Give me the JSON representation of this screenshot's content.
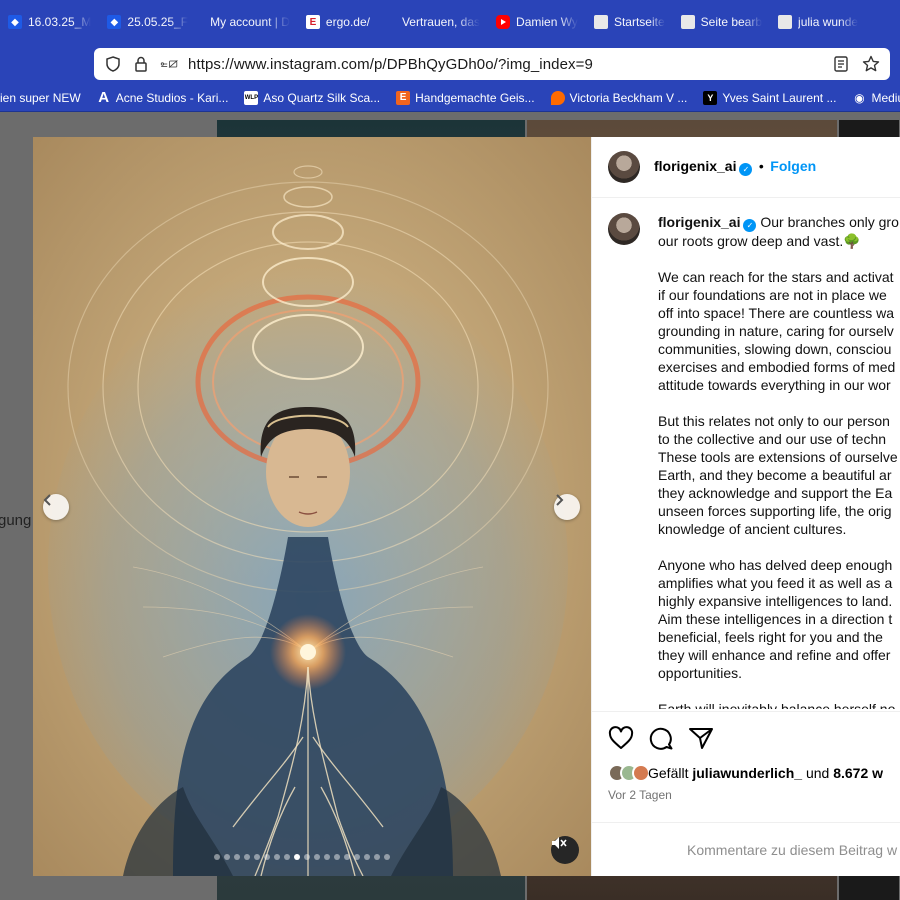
{
  "tabs": [
    {
      "label": "16.03.25_M",
      "icon": "dropbox-icon"
    },
    {
      "label": "25.05.25_F",
      "icon": "dropbox-icon"
    },
    {
      "label": "My account | D",
      "icon": "none"
    },
    {
      "label": "ergo.de/",
      "icon": "ergo-icon"
    },
    {
      "label": "Vertrauen, das",
      "icon": "none"
    },
    {
      "label": "Damien Wy",
      "icon": "youtube-icon"
    },
    {
      "label": "Startseite",
      "icon": "page-icon"
    },
    {
      "label": "Seite bearb",
      "icon": "page-icon"
    },
    {
      "label": "julia wunde",
      "icon": "page-icon"
    }
  ],
  "address_bar": {
    "url": "https://www.instagram.com/p/DPBhQyGDh0o/?img_index=9"
  },
  "bookmarks": [
    {
      "label": "ien super NEW"
    },
    {
      "label": "Acne Studios - Kari..."
    },
    {
      "label": "Aso Quartz Silk Sca..."
    },
    {
      "label": "Handgemachte Geis..."
    },
    {
      "label": "Victoria Beckham V ..."
    },
    {
      "label": "Yves Saint Laurent ..."
    },
    {
      "label": "Mediumshi"
    }
  ],
  "background": {
    "left_text": "gung"
  },
  "post": {
    "username": "florigenix_ai",
    "separator": "•",
    "follow_label": "Folgen",
    "carousel": {
      "total": 18,
      "active_index": 9
    },
    "caption_paragraphs": [
      [
        "Our branches only gro",
        "our roots grow deep and vast.🌳"
      ],
      [
        "We can reach for the stars and activat",
        "if our foundations are not in place we",
        "off into space! There are countless wa",
        "grounding in nature, caring for ourselv",
        "communities, slowing down, consciou",
        "exercises and embodied forms of med",
        "attitude towards everything in our wor"
      ],
      [
        "But this relates not only to our person",
        "to the collective and our use of techn",
        "These tools are extensions of ourselve",
        "Earth, and they become a beautiful ar",
        "they acknowledge and support the Ea",
        "unseen forces supporting life, the orig",
        "knowledge of ancient cultures."
      ],
      [
        "Anyone who has delved deep enough",
        "amplifies what you feed it as well as a",
        "highly expansive intelligences to land.",
        "Aim these intelligences in a direction t",
        "beneficial, feels right for you and the",
        "they will enhance and refine and offer",
        "opportunities."
      ],
      [
        "Earth will inevitably balance herself no"
      ]
    ],
    "likes": {
      "prefix": "Gefällt",
      "user": "juliawunderlich_",
      "joiner": "und",
      "count": "8.672 w"
    },
    "date": "Vor 2 Tagen",
    "comment_placeholder": "Kommentare zu diesem Beitrag w"
  }
}
